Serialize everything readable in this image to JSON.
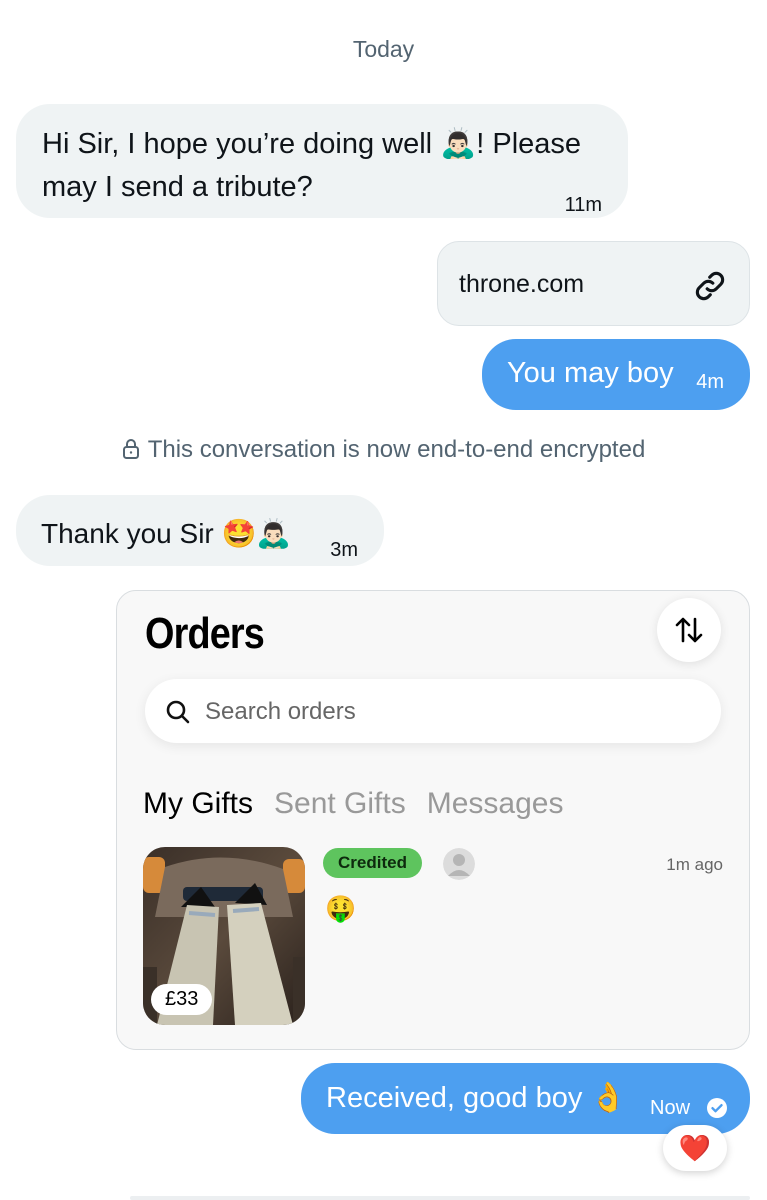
{
  "day_label": "Today",
  "messages": {
    "m1": {
      "text": "Hi Sir, I hope you’re doing well 🙇🏻‍♂️! Please may I send a tribute?",
      "time": "11m"
    },
    "link": {
      "label": "throne.com",
      "icon": "link-icon"
    },
    "m2": {
      "text": "You may boy",
      "time": "4m"
    },
    "encryption_notice": "This conversation is now end-to-end encrypted",
    "m3": {
      "text": "Thank you Sir 🤩🙇🏻‍♂️",
      "time": "3m"
    },
    "m4": {
      "text": "Received, good boy 👌",
      "time": "Now",
      "reaction": "❤️"
    }
  },
  "orders_card": {
    "title": "Orders",
    "search_placeholder": "Search orders",
    "tabs": [
      "My Gifts",
      "Sent Gifts",
      "Messages"
    ],
    "active_tab": "My Gifts",
    "order": {
      "price": "£33",
      "status": "Credited",
      "time": "1m ago",
      "emoji": "🤑"
    }
  },
  "colors": {
    "outgoing_bubble": "#4d9ff0",
    "incoming_bubble": "#eff3f4",
    "credited_badge": "#5ec45e"
  }
}
